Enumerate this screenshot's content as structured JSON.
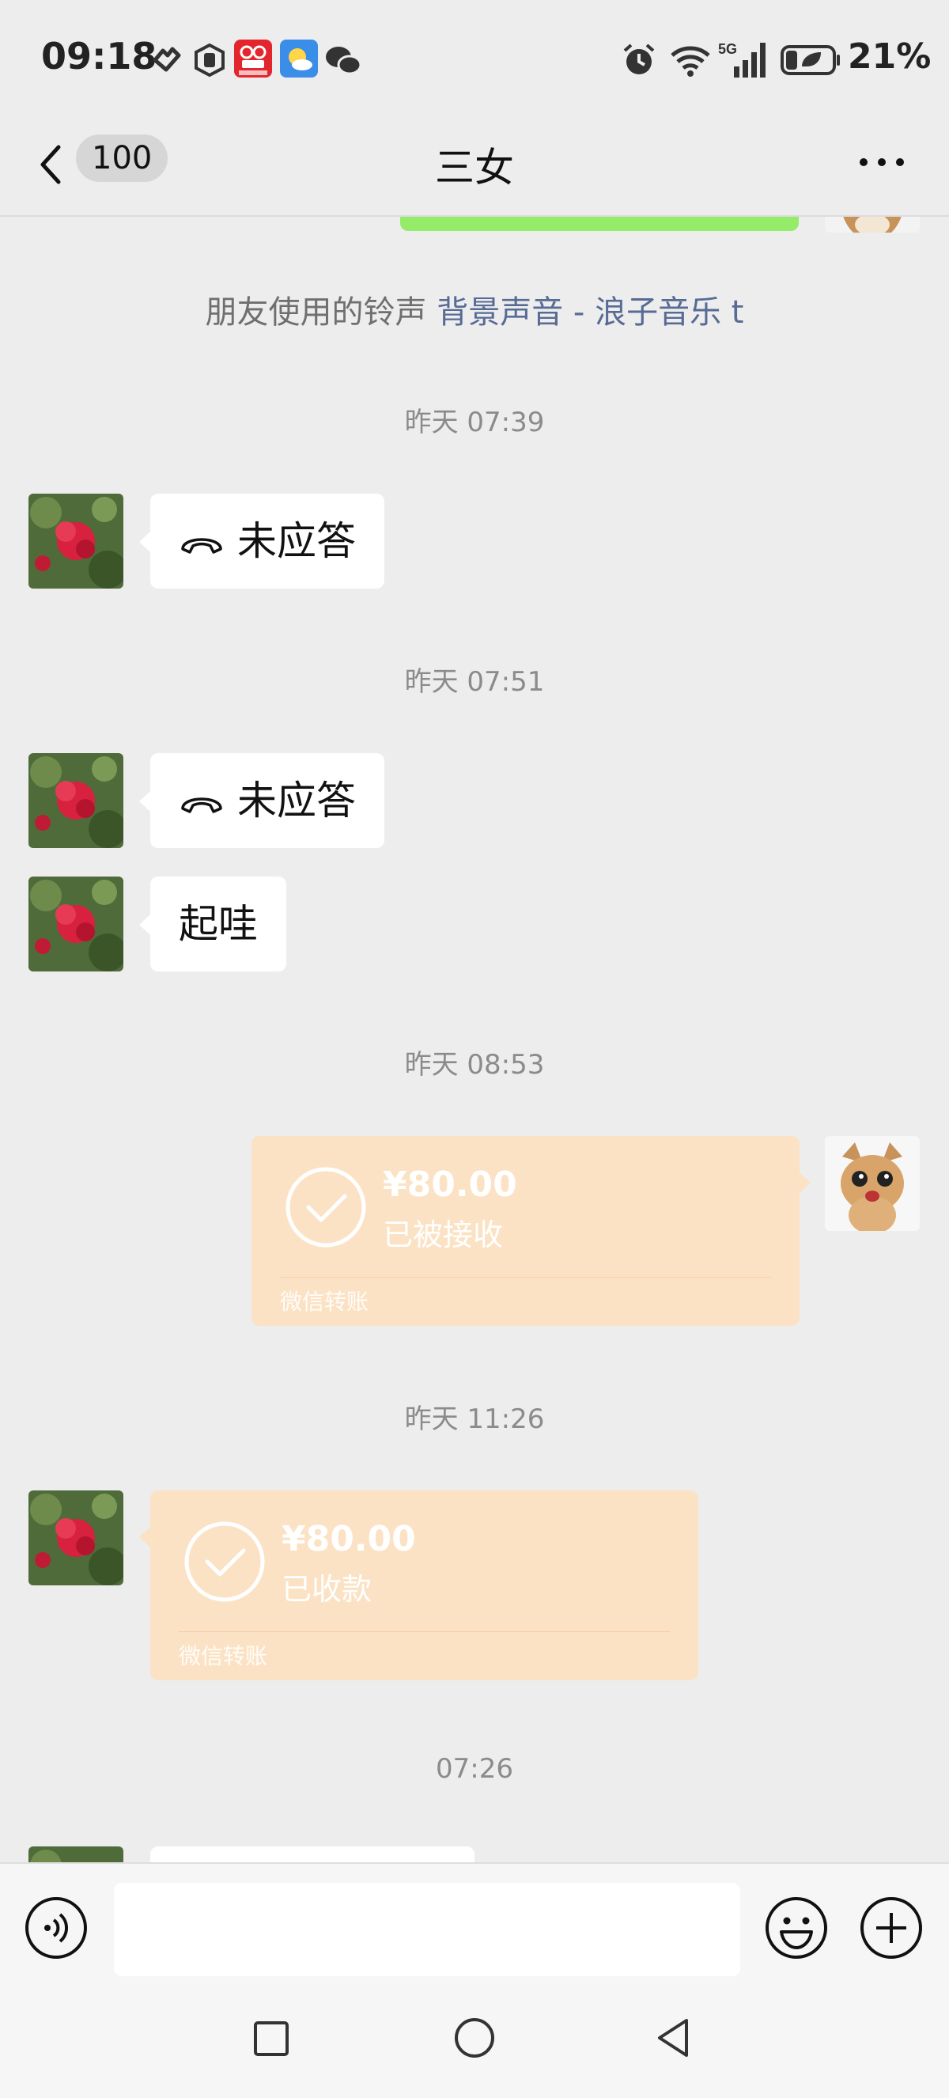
{
  "status_bar": {
    "time": "09:18",
    "battery_percent": "21%",
    "network": "5G",
    "icons": [
      "heart-icon",
      "hand-icon",
      "app-notification-icon",
      "weather-icon",
      "wechat-icon",
      "alarm-icon",
      "wifi-icon",
      "signal-icon",
      "battery-icon"
    ]
  },
  "nav": {
    "back_icon": "chevron-left-icon",
    "unread_count": "100",
    "title": "三女",
    "more_icon": "more-dots-icon"
  },
  "ringtone_notice": {
    "prefix": "朋友使用的铃声",
    "link": "背景声音 - 浪子音乐 t"
  },
  "messages": [
    {
      "type": "timestamp",
      "text": "昨天 07:39"
    },
    {
      "type": "call",
      "side": "left",
      "icon": "phone-hangup-icon",
      "text": "未应答"
    },
    {
      "type": "timestamp",
      "text": "昨天 07:51"
    },
    {
      "type": "call",
      "side": "left",
      "icon": "phone-hangup-icon",
      "text": "未应答"
    },
    {
      "type": "text",
      "side": "left",
      "text": "起哇"
    },
    {
      "type": "timestamp",
      "text": "昨天 08:53"
    },
    {
      "type": "transfer",
      "side": "right",
      "amount": "¥80.00",
      "status": "已被接收",
      "footer": "微信转账"
    },
    {
      "type": "timestamp",
      "text": "昨天 11:26"
    },
    {
      "type": "transfer",
      "side": "left",
      "amount": "¥80.00",
      "status": "已收款",
      "footer": "微信转账"
    },
    {
      "type": "timestamp",
      "text": "07:26"
    }
  ],
  "input_bar": {
    "voice_icon": "voice-icon",
    "input_value": "",
    "emoji_icon": "emoji-icon",
    "plus_icon": "plus-icon"
  },
  "system_nav": [
    "square-recents-icon",
    "circle-home-icon",
    "triangle-back-icon"
  ],
  "colors": {
    "background": "#ededed",
    "transfer_bubble": "#fce2c4",
    "link": "#576b95",
    "sent_bubble": "#95ec69"
  }
}
